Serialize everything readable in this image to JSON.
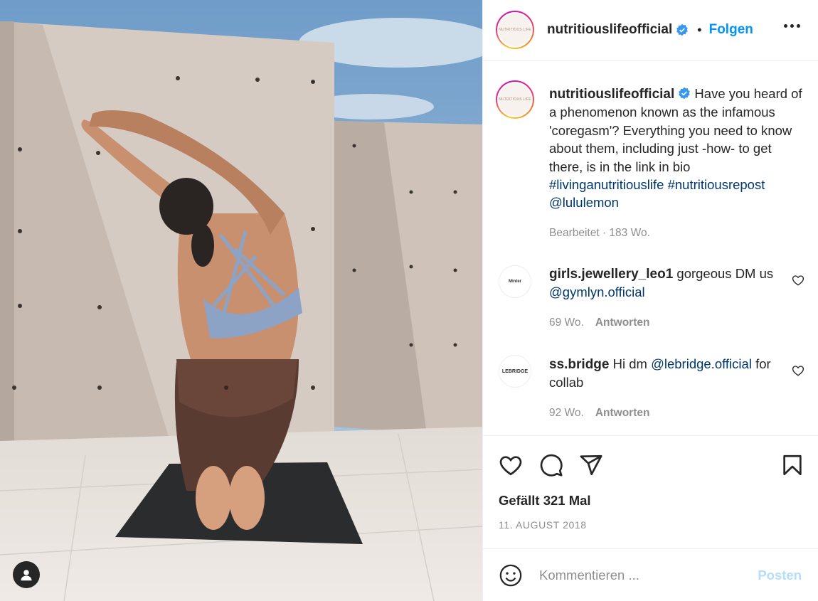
{
  "post": {
    "image_description_icon": "photo",
    "tag_button_icon": "user-icon"
  },
  "header": {
    "avatar_text": "NUTRITIOUS LIFE",
    "username": "nutritiouslifeofficial",
    "separator": "•",
    "follow_label": "Folgen",
    "more_icon": "more-options-icon"
  },
  "caption": {
    "avatar_text": "NUTRITIOUS LIFE",
    "username": "nutritiouslifeofficial",
    "text": "Have you heard of a phenomenon known as the infamous 'coregasm'? Everything you need to know about them, including just -how- to get there, is in the link in bio",
    "hashtag1": "#livinganutritiouslife",
    "hashtag2": "#nutritiousrepost",
    "mention": "@lululemon",
    "meta": "Bearbeitet · 183 Wo."
  },
  "comments": [
    {
      "avatar_text": "Minter",
      "username": "girls.jewellery_leo1",
      "text": "gorgeous DM us",
      "mention": "@gymlyn.official",
      "time": "69 Wo.",
      "reply_label": "Antworten"
    },
    {
      "avatar_text": "LEBRIDGE",
      "username": "ss.bridge",
      "text": "Hi dm",
      "mention": "@lebridge.official",
      "text_after": "for collab",
      "time": "92 Wo.",
      "reply_label": "Antworten"
    }
  ],
  "actions": {
    "likes": "Gefällt 321 Mal",
    "date": "11. AUGUST 2018"
  },
  "composer": {
    "placeholder": "Kommentieren ...",
    "post_label": "Posten"
  },
  "colors": {
    "accent": "#0095f6",
    "link": "#00376b",
    "post_disabled": "#b2dffc",
    "muted": "#8e8e8e"
  }
}
